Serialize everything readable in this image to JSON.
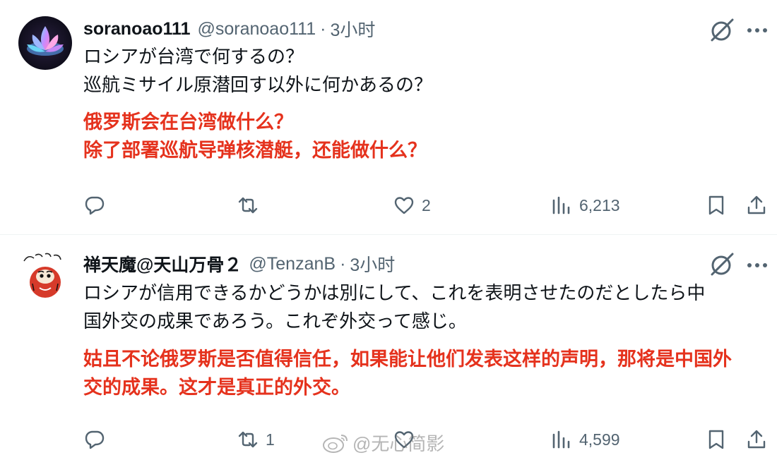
{
  "tweets": [
    {
      "name": "soranoao111",
      "handle": "@soranoao111",
      "separator": "·",
      "time": "3小时",
      "text_lines": [
        "ロシアが台湾で何するの？",
        "巡航ミサイル原潜回す以外に何かあるの？"
      ],
      "translation_lines": [
        "俄罗斯会在台湾做什么？",
        "除了部署巡航导弹核潜艇，还能做什么？"
      ],
      "actions": {
        "replies": "",
        "retweets": "",
        "likes": "2",
        "views": "6,213"
      },
      "avatar_icon": "lotus-avatar"
    },
    {
      "name": "禅天魔@天山万骨２",
      "handle": "@TenzanB",
      "separator": "·",
      "time": "3小时",
      "text_lines": [
        "ロシアが信用できるかどうかは別にして、これを表明させたのだとしたら中",
        "国外交の成果であろう。これぞ外交って感じ。"
      ],
      "translation_lines": [
        "姑且不论俄罗斯是否值得信任，如果能让他们发表这样的声明，那将是中国外",
        "交的成果。这才是真正的外交。"
      ],
      "actions": {
        "replies": "",
        "retweets": "1",
        "likes": "",
        "views": "4,599"
      },
      "avatar_icon": "daruma-avatar"
    }
  ],
  "watermark": "@无心简影",
  "colors": {
    "accent_red": "#e5321d",
    "muted": "#536471",
    "text": "#0f1419"
  }
}
